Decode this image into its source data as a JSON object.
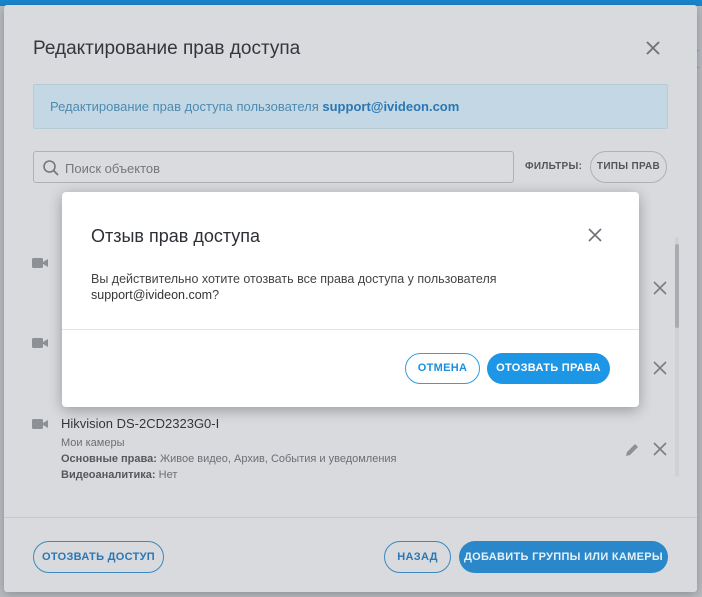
{
  "main_dialog": {
    "title": "Редактирование прав доступа",
    "banner_prefix": "Редактирование прав доступа пользователя ",
    "banner_user": "support@ivideon.com",
    "search_placeholder": "Поиск объектов",
    "filters_label": "ФИЛЬТРЫ:",
    "rights_types_button": "ТИПЫ ПРАВ",
    "device": {
      "name": "Hikvision DS-2CD2323G0-I",
      "group": "Мои камеры",
      "rights_label": "Основные права:",
      "rights_value": " Живое видео, Архив, События и уведомления",
      "analytics_label": "Видеоаналитика:",
      "analytics_value": " Нет"
    },
    "footer": {
      "revoke_access": "ОТОЗВАТЬ ДОСТУП",
      "back": "НАЗАД",
      "add_groups": "ДОБАВИТЬ ГРУППЫ ИЛИ КАМЕРЫ"
    }
  },
  "confirm_dialog": {
    "title": "Отзыв прав доступа",
    "message_line1": "Вы действительно хотите отозвать все права доступа у пользователя",
    "message_user": "support@ivideon.com",
    "message_suffix": "?",
    "cancel": "ОТМЕНА",
    "revoke": "ОТОЗВАТЬ ПРАВА"
  },
  "colors": {
    "accent": "#1e96e6",
    "overlay": "#d8dadd"
  }
}
